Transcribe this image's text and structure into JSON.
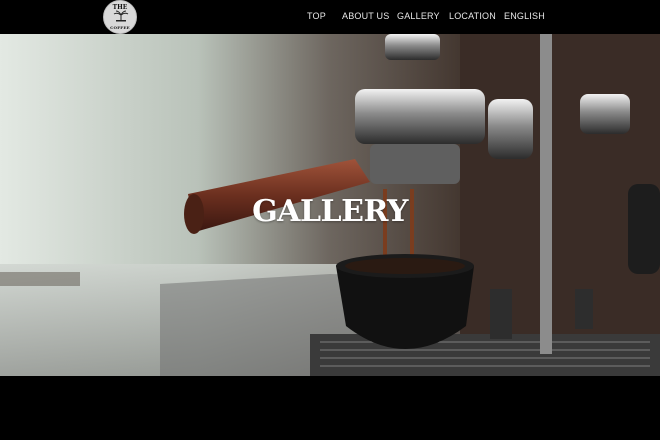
{
  "logo": {
    "top_text": "THE",
    "bottom_text": "COFFEE"
  },
  "nav": {
    "items": [
      {
        "label": "TOP"
      },
      {
        "label": "ABOUT US"
      },
      {
        "label": "GALLERY"
      },
      {
        "label": "LOCATION"
      },
      {
        "label": "ENGLISH"
      }
    ]
  },
  "hero": {
    "title": "GALLERY"
  },
  "colors": {
    "topbar": "#000000",
    "title": "#ffffff",
    "nav_text": "#e8e8e8"
  }
}
